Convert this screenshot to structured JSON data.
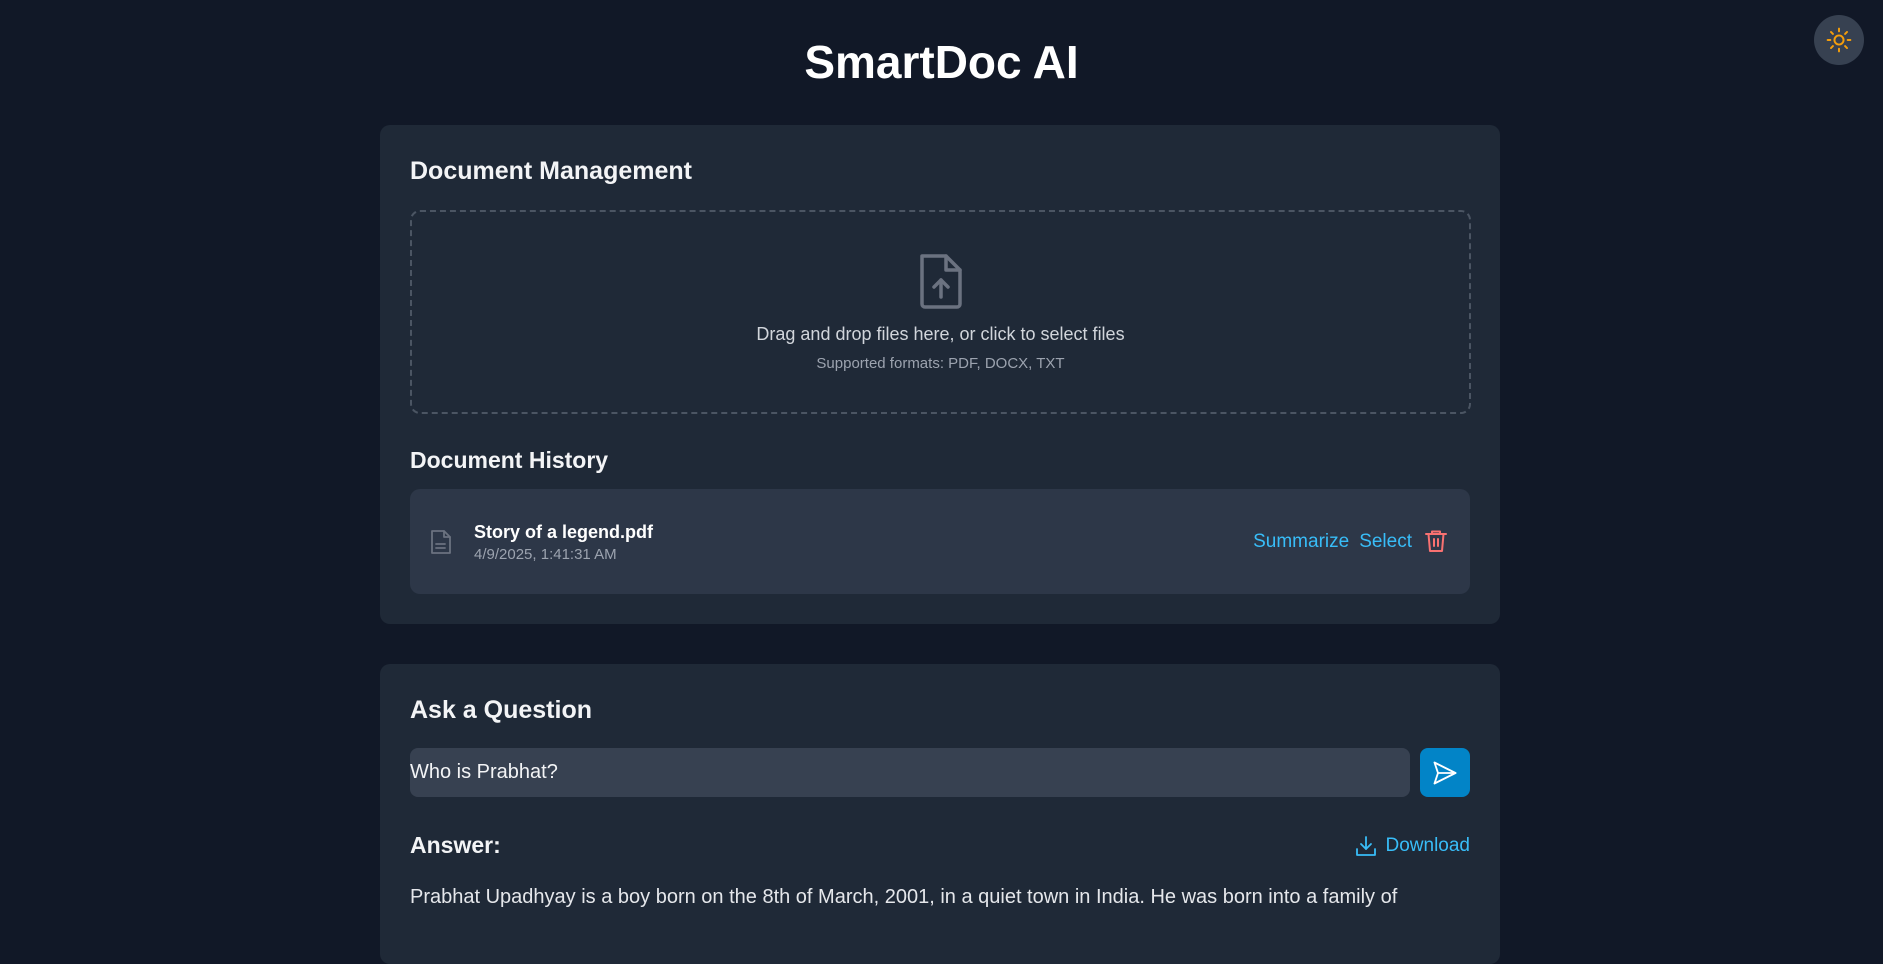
{
  "app": {
    "title": "SmartDoc AI",
    "theme_toggle_icon": "sun-icon"
  },
  "colors": {
    "background": "#111827",
    "card": "#1f2937",
    "accent": "#38bdf8",
    "button": "#0284c7",
    "danger": "#f87171",
    "sun": "#f59e0b"
  },
  "document_management": {
    "title": "Document Management",
    "dropzone": {
      "icon": "file-upload-icon",
      "text": "Drag and drop files here, or click to select files",
      "subtext": "Supported formats: PDF, DOCX, TXT"
    },
    "history_title": "Document History",
    "documents": [
      {
        "icon": "file-text-icon",
        "name": "Story of a legend.pdf",
        "date": "4/9/2025, 1:41:31 AM",
        "summarize_label": "Summarize",
        "select_label": "Select",
        "delete_icon": "trash-icon"
      }
    ]
  },
  "qa": {
    "title": "Ask a Question",
    "input_value": "Who is Prabhat?",
    "send_icon": "send-icon",
    "answer_label": "Answer:",
    "download_label": "Download",
    "download_icon": "download-icon",
    "answer_text": "Prabhat Upadhyay is a boy born on the 8th of March, 2001, in a quiet town in India. He was born into a family of"
  }
}
